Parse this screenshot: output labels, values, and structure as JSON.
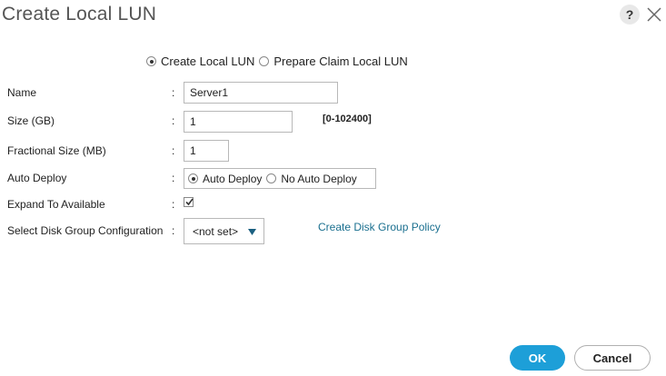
{
  "dialog": {
    "title": "Create Local LUN",
    "help_symbol": "?"
  },
  "mode": {
    "options": [
      {
        "label": "Create Local LUN",
        "selected": true
      },
      {
        "label": "Prepare Claim Local LUN",
        "selected": false
      }
    ]
  },
  "form": {
    "name": {
      "label": "Name",
      "value": "Server1"
    },
    "size": {
      "label": "Size (GB)",
      "value": "1",
      "range": "[0-102400]"
    },
    "fractional_size": {
      "label": "Fractional Size (MB)",
      "value": "1"
    },
    "auto_deploy": {
      "label": "Auto Deploy",
      "options": [
        {
          "label": "Auto Deploy",
          "selected": true
        },
        {
          "label": "No Auto Deploy",
          "selected": false
        }
      ]
    },
    "expand_to_available": {
      "label": "Expand To Available",
      "checked": true
    },
    "disk_group_config": {
      "label": "Select Disk Group Configuration",
      "selected": "<not set>",
      "link": "Create Disk Group Policy"
    },
    "colon": ":"
  },
  "footer": {
    "ok_label": "OK",
    "cancel_label": "Cancel"
  },
  "colors": {
    "primary_button": "#1d9fd8",
    "link": "#1a6f8f",
    "title": "#555555"
  },
  "icons": {
    "close": "close-icon",
    "help": "help-icon",
    "caret": "caret-down-icon",
    "check": "checkmark-icon"
  }
}
